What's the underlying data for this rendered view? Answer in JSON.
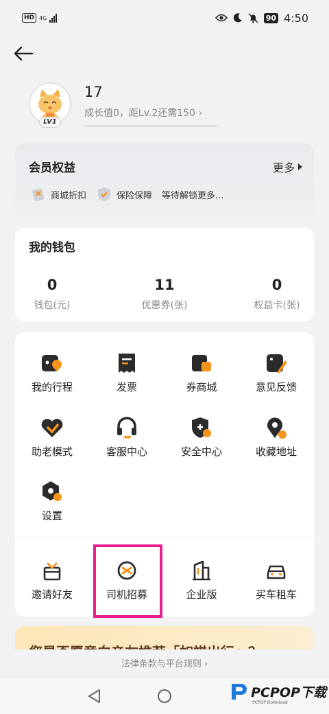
{
  "status_bar": {
    "hd": "HD",
    "network": "4G",
    "battery": "90",
    "time": "4:50"
  },
  "profile": {
    "username": "17",
    "growth_text": "成长值0，距Lv.2还需150",
    "level_badge": "LV1",
    "growth_progress": 0
  },
  "benefits": {
    "title": "会员权益",
    "more": "更多",
    "items": [
      {
        "label": "商城折扣",
        "icon": "mall-discount-icon"
      },
      {
        "label": "保险保障",
        "icon": "insurance-shield-icon"
      },
      {
        "label": "等待解锁更多..."
      }
    ]
  },
  "wallet": {
    "title": "我的钱包",
    "items": [
      {
        "value": "0",
        "label": "钱包(元)"
      },
      {
        "value": "11",
        "label": "优惠券(张)"
      },
      {
        "value": "0",
        "label": "权益卡(张)"
      }
    ]
  },
  "services": {
    "items": [
      {
        "label": "我的行程",
        "icon": "trip-icon"
      },
      {
        "label": "发票",
        "icon": "invoice-icon"
      },
      {
        "label": "券商城",
        "icon": "coupon-mall-icon"
      },
      {
        "label": "意见反馈",
        "icon": "feedback-icon"
      },
      {
        "label": "助老模式",
        "icon": "elderly-mode-icon"
      },
      {
        "label": "客服中心",
        "icon": "headset-icon"
      },
      {
        "label": "安全中心",
        "icon": "safety-shield-icon"
      },
      {
        "label": "收藏地址",
        "icon": "location-pin-icon"
      },
      {
        "label": "设置",
        "icon": "settings-icon"
      }
    ],
    "extra": [
      {
        "label": "邀请好友",
        "icon": "gift-box-icon"
      },
      {
        "label": "司机招募",
        "icon": "steering-wheel-icon"
      },
      {
        "label": "企业版",
        "icon": "building-icon"
      },
      {
        "label": "买车租车",
        "icon": "car-icon"
      }
    ]
  },
  "banner": {
    "text": "您是否愿意向亲友推荐「如祺出行」？"
  },
  "legal": {
    "label": "法律条款与平台规则"
  },
  "watermark": {
    "brand": "PCPOP下载",
    "sub": "PCPOP Download"
  },
  "colors": {
    "accent_orange": "#f7941d",
    "icon_dark": "#2b2b2b",
    "highlight_pink": "#ea1e8e"
  }
}
